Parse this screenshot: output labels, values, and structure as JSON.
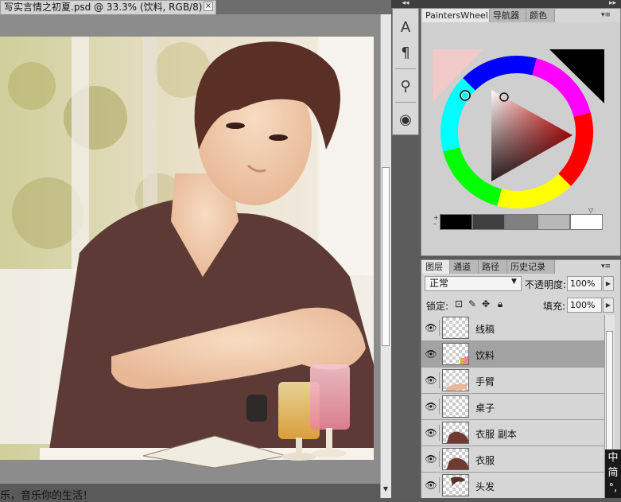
{
  "document": {
    "tab_title": "写实言情之初夏.psd @ 33.3% (饮料, RGB/8) *",
    "close_glyph": "×",
    "bottom_text": "乐，音乐你的生活！"
  },
  "tools": {
    "header_glyph": "◂◂",
    "items": [
      {
        "name": "character",
        "glyph": "A"
      },
      {
        "name": "paragraph",
        "glyph": "¶"
      },
      {
        "name": "clone-source",
        "glyph": "⚲"
      },
      {
        "name": "brushes",
        "glyph": "◉"
      }
    ]
  },
  "right_header_glyph": "▸▸",
  "color_panel": {
    "tabs": [
      "PaintersWheel",
      "导航器",
      "颜色"
    ],
    "active_tab": 0,
    "menu_glyph": "▾≡",
    "colors": {
      "background": "#f2c9c9",
      "foreground": "#000000",
      "hue": "#ff1a1a"
    },
    "swatches": [
      "#000000",
      "#404040",
      "#808080",
      "#b8b8b8",
      "#ffffff"
    ],
    "plus_minus": [
      "+",
      "–"
    ],
    "arrow_glyph": "▽"
  },
  "layers_panel": {
    "tabs": [
      "图层",
      "通道",
      "路径",
      "历史记录"
    ],
    "active_tab": 0,
    "menu_glyph": "▾≡",
    "blend_mode": "正常",
    "opacity_label": "不透明度:",
    "opacity_value": "100%",
    "lock_label": "锁定:",
    "fill_label": "填充:",
    "fill_value": "100%",
    "layers": [
      {
        "name": "线稿",
        "visible": true,
        "selected": false,
        "thumb": "empty"
      },
      {
        "name": "饮料",
        "visible": true,
        "selected": true,
        "thumb": "drink"
      },
      {
        "name": "手臂",
        "visible": true,
        "selected": false,
        "thumb": "arm"
      },
      {
        "name": "桌子",
        "visible": true,
        "selected": false,
        "thumb": "empty"
      },
      {
        "name": "衣服 副本",
        "visible": true,
        "selected": false,
        "thumb": "shirt"
      },
      {
        "name": "衣服",
        "visible": true,
        "selected": false,
        "thumb": "shirt"
      },
      {
        "name": "头发",
        "visible": true,
        "selected": false,
        "thumb": "hair"
      }
    ]
  },
  "ime": {
    "buttons": [
      "中",
      "简",
      "°,"
    ]
  }
}
